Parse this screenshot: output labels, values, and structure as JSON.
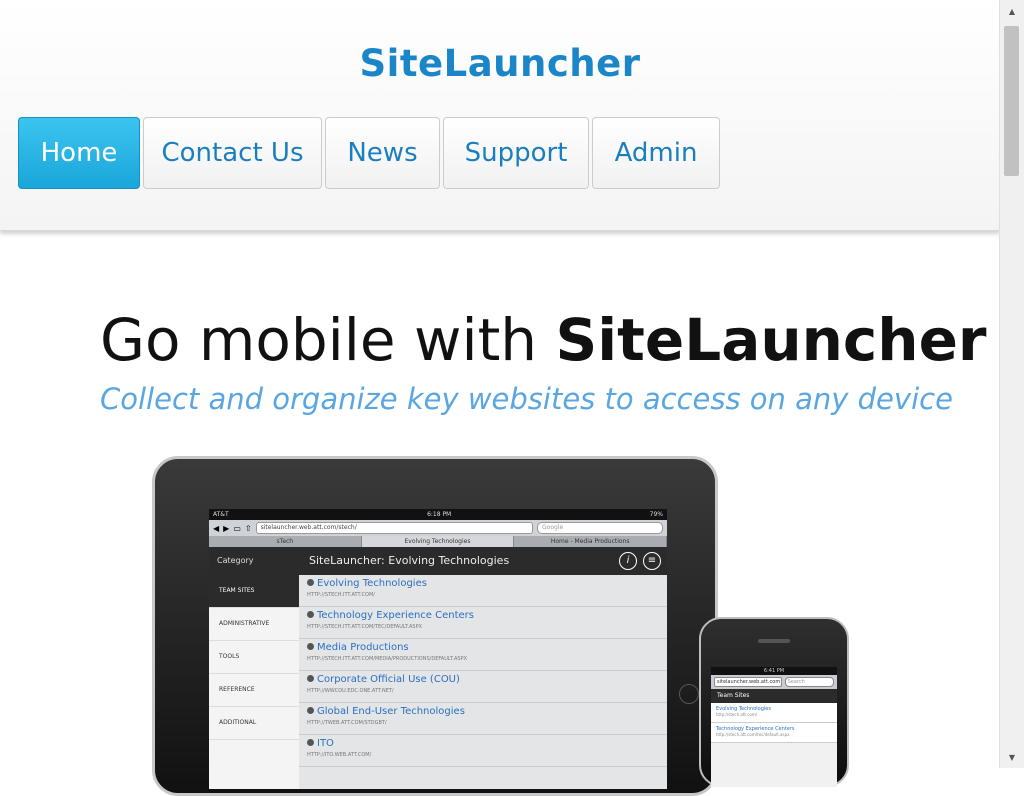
{
  "header": {
    "brand": "SiteLauncher",
    "nav": [
      {
        "label": "Home",
        "active": true
      },
      {
        "label": "Contact Us",
        "active": false
      },
      {
        "label": "News",
        "active": false
      },
      {
        "label": "Support",
        "active": false
      },
      {
        "label": "Admin",
        "active": false
      }
    ]
  },
  "hero": {
    "title_prefix": "Go mobile with ",
    "title_brand": "SiteLauncher",
    "subtitle": "Collect and organize key websites to access on any device"
  },
  "tablet": {
    "status_left": "AT&T",
    "status_center": "6:18 PM",
    "status_right": "79%",
    "url": "sitelauncher.web.att.com/stech/",
    "search_placeholder": "Google",
    "tabs": [
      "sTech",
      "Evolving Technologies",
      "Home - Media Productions"
    ],
    "sidebar_title": "Category",
    "categories": [
      "TEAM SITES",
      "ADMINISTRATIVE",
      "TOOLS",
      "REFERENCE",
      "ADDITIONAL"
    ],
    "main_title": "SiteLauncher: Evolving Technologies",
    "sites": [
      {
        "name": "Evolving Technologies",
        "url": "HTTP://STECH.ITT.ATT.COM/"
      },
      {
        "name": "Technology Experience Centers",
        "url": "HTTP://STECH.ITT.ATT.COM/TEC/DEFAULT.ASPX"
      },
      {
        "name": "Media Productions",
        "url": "HTTP://STECH.ITT.ATT.COM/MEDIA/PRODUCTIONS/DEFAULT.ASPX"
      },
      {
        "name": "Corporate Official Use (COU)",
        "url": "HTTP://WWCOU.EDC.ONE.ATT.NET/"
      },
      {
        "name": "Global End-User Technologies",
        "url": "HTTP://TWEB.ATT.COM/STDGBT/"
      },
      {
        "name": "ITO",
        "url": "HTTP://ITO.WEB.ATT.COM/"
      }
    ]
  },
  "phone": {
    "status": "6:41 PM",
    "url": "sitelauncher.web.att.com",
    "search_placeholder": "Search",
    "section_title": "Team Sites",
    "sites": [
      {
        "name": "Evolving Technologies",
        "url": "http://stech.att.com/"
      },
      {
        "name": "Technology Experience Centers",
        "url": "http://stech.att.com/tec/default.aspx"
      }
    ]
  },
  "colors": {
    "brand": "#1a86c8",
    "nav_active": "#1aa6da",
    "subtitle": "#5aa6e0"
  }
}
